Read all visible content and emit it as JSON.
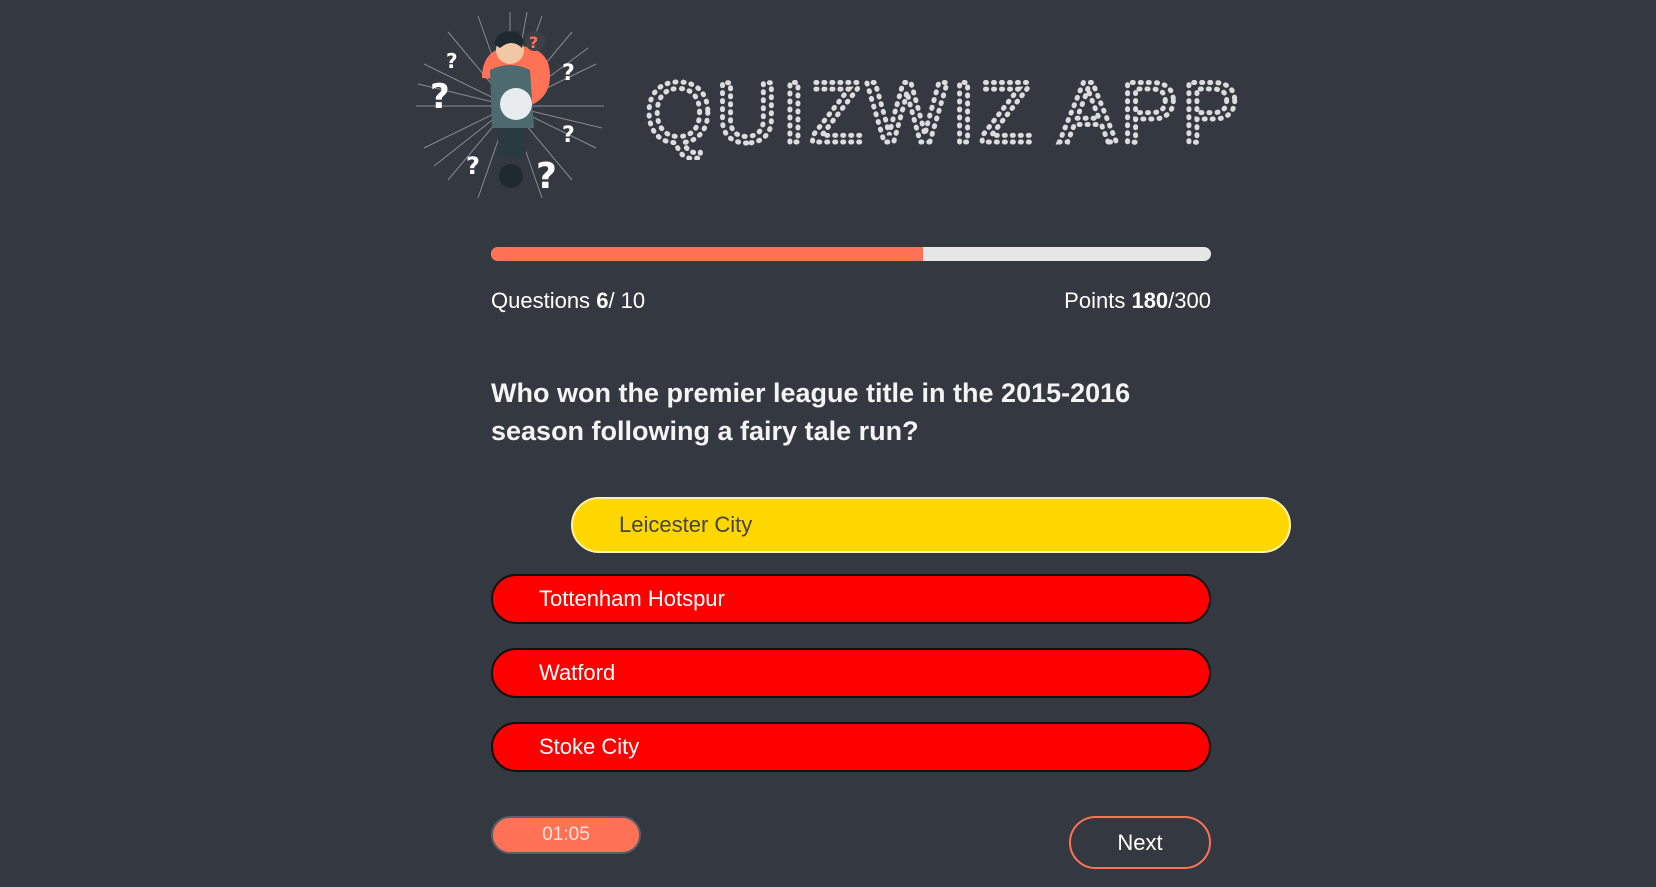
{
  "header": {
    "logo_icon": "confused-person-question-marks-illustration",
    "title": "QUIZWIZ APP"
  },
  "progress": {
    "fraction": 0.6,
    "fill_color": "#ff7256",
    "track_color": "#e6e6e6"
  },
  "stats": {
    "questions_label": "Questions",
    "questions_current": "6",
    "questions_total": "/ 10",
    "points_label": "Points",
    "points_current": "180",
    "points_total": "/300"
  },
  "question": {
    "text": "Who won the premier league title in the 2015-2016 season following a fairy tale run?"
  },
  "options": [
    {
      "label": "Leicester City",
      "state": "selected",
      "color": "#ffd700"
    },
    {
      "label": "Tottenham Hotspur",
      "state": "wrong",
      "color": "#ff0000"
    },
    {
      "label": "Watford",
      "state": "wrong",
      "color": "#ff0000"
    },
    {
      "label": "Stoke City",
      "state": "wrong",
      "color": "#ff0000"
    }
  ],
  "footer": {
    "timer": "01:05",
    "next_label": "Next"
  },
  "colors": {
    "background": "#343840",
    "accent": "#ff7256"
  }
}
